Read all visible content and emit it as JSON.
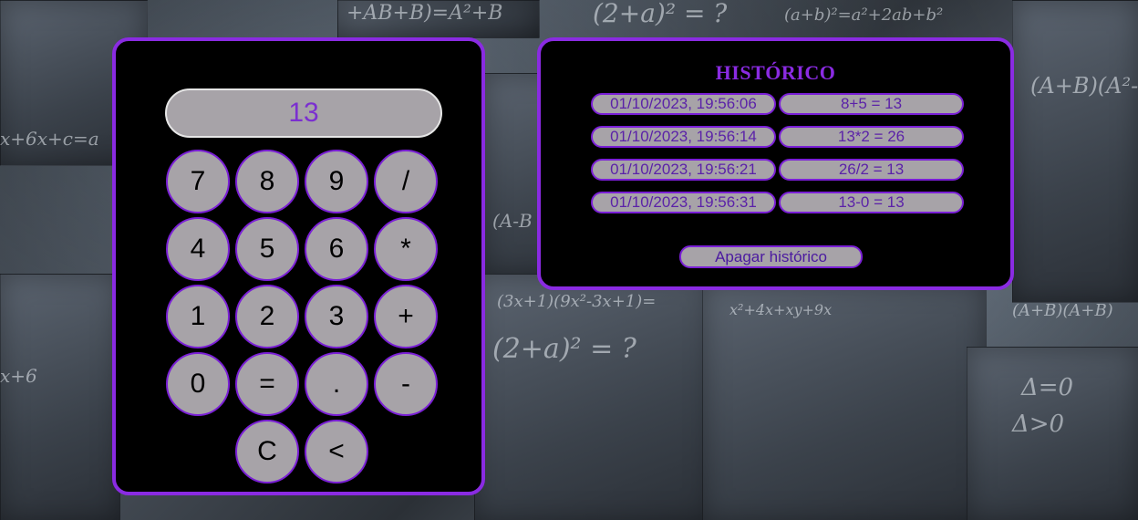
{
  "calculator": {
    "display_value": "13",
    "keys": [
      [
        "7",
        "8",
        "9",
        "/"
      ],
      [
        "4",
        "5",
        "6",
        "*"
      ],
      [
        "1",
        "2",
        "3",
        "+"
      ],
      [
        "0",
        "=",
        ".",
        "-"
      ],
      [
        "C",
        "<"
      ]
    ]
  },
  "history": {
    "title": "HISTÓRICO",
    "entries": [
      {
        "timestamp": "01/10/2023, 19:56:06",
        "operation": "8+5 = 13"
      },
      {
        "timestamp": "01/10/2023, 19:56:14",
        "operation": "13*2 = 26"
      },
      {
        "timestamp": "01/10/2023, 19:56:21",
        "operation": "26/2 = 13"
      },
      {
        "timestamp": "01/10/2023, 19:56:31",
        "operation": "13-0 = 13"
      }
    ],
    "clear_label": "Apagar histórico"
  },
  "theme": {
    "accent": "#8a2be2",
    "panel_bg": "#000000",
    "key_bg": "#a7a3a8"
  }
}
